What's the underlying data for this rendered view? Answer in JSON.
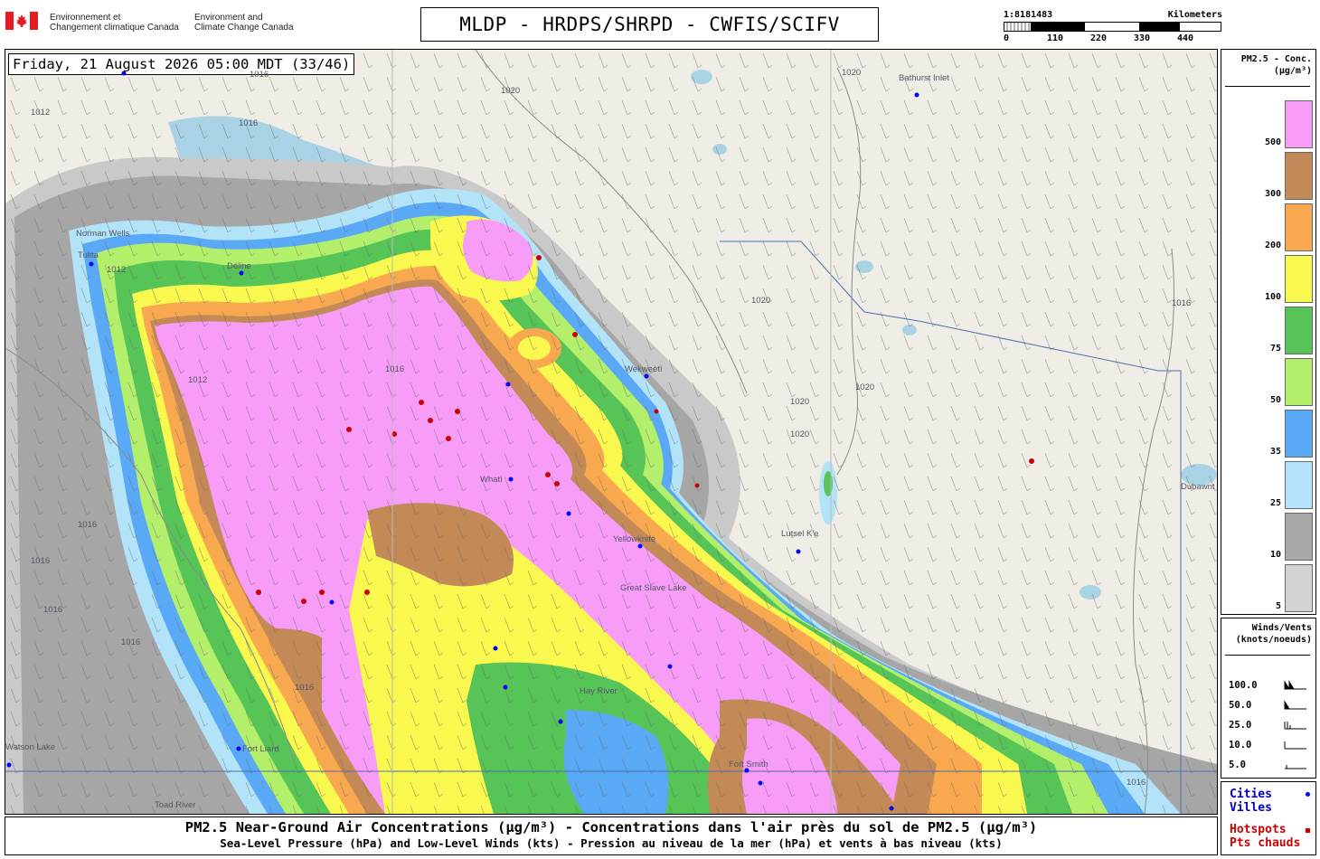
{
  "header": {
    "agency_fr_line1": "Environnement et",
    "agency_fr_line2": "Changement climatique Canada",
    "agency_en_line1": "Environment and",
    "agency_en_line2": "Climate Change Canada",
    "title": "MLDP - HRDPS/SHRPD - CWFIS/SCIFV"
  },
  "scale_bar": {
    "ratio": "1:8181483",
    "unit": "Kilometers",
    "ticks": [
      "0",
      "110",
      "220",
      "330",
      "440"
    ]
  },
  "map": {
    "timestamp": "Friday, 21 August 2026 05:00 MDT (33/46)",
    "places": [
      "Bathurst Inlet",
      "Norman Wells",
      "Tulita",
      "Déline",
      "Wekweètì",
      "Whatì",
      "Yellowknife",
      "Great Slave Lake",
      "Lutsel K'e",
      "Dubawnt Lake",
      "Hay River",
      "Fort Liard",
      "Fort Smith",
      "Watson Lake",
      "Toad River"
    ],
    "isobars": [
      "1020",
      "1020",
      "1020",
      "1020",
      "1020",
      "1020",
      "1016",
      "1016",
      "1016",
      "1016",
      "1016",
      "1016",
      "1016",
      "1016",
      "1016",
      "1016",
      "1012",
      "1012",
      "1012"
    ]
  },
  "legend": {
    "title_line1": "PM2.5 - Conc.",
    "title_line2": "(µg/m³)",
    "levels": [
      {
        "label": "500",
        "color": "#f79cf7"
      },
      {
        "label": "300",
        "color": "#c38a57"
      },
      {
        "label": "200",
        "color": "#f8a84e"
      },
      {
        "label": "100",
        "color": "#f8f84f"
      },
      {
        "label": "75",
        "color": "#57c457"
      },
      {
        "label": "50",
        "color": "#b3ef6b"
      },
      {
        "label": "35",
        "color": "#5aa9f7"
      },
      {
        "label": "25",
        "color": "#b3e3f8"
      },
      {
        "label": "10",
        "color": "#a9a9a9"
      },
      {
        "label": "5",
        "color": "#d4d4d4"
      }
    ]
  },
  "winds_legend": {
    "title_line1": "Winds/Vents",
    "title_line2": "(knots/noeuds)",
    "rows": [
      "100.0",
      "50.0",
      "25.0",
      "10.0",
      "5.0"
    ]
  },
  "keys": {
    "cities_en": "Cities",
    "cities_fr": "Villes",
    "cities_color": "#0000ff",
    "hotspots_en": "Hotspots",
    "hotspots_fr": "Pts chauds",
    "hotspots_color": "#cc0000"
  },
  "footer": {
    "line1": "PM2.5 Near-Ground Air Concentrations (µg/m³) - Concentrations dans l'air près du sol de PM2.5 (µg/m³)",
    "line2": "Sea-Level Pressure (hPa) and Low-Level Winds (kts) - Pression au niveau de la mer (hPa) et vents à bas niveau (kts)"
  }
}
